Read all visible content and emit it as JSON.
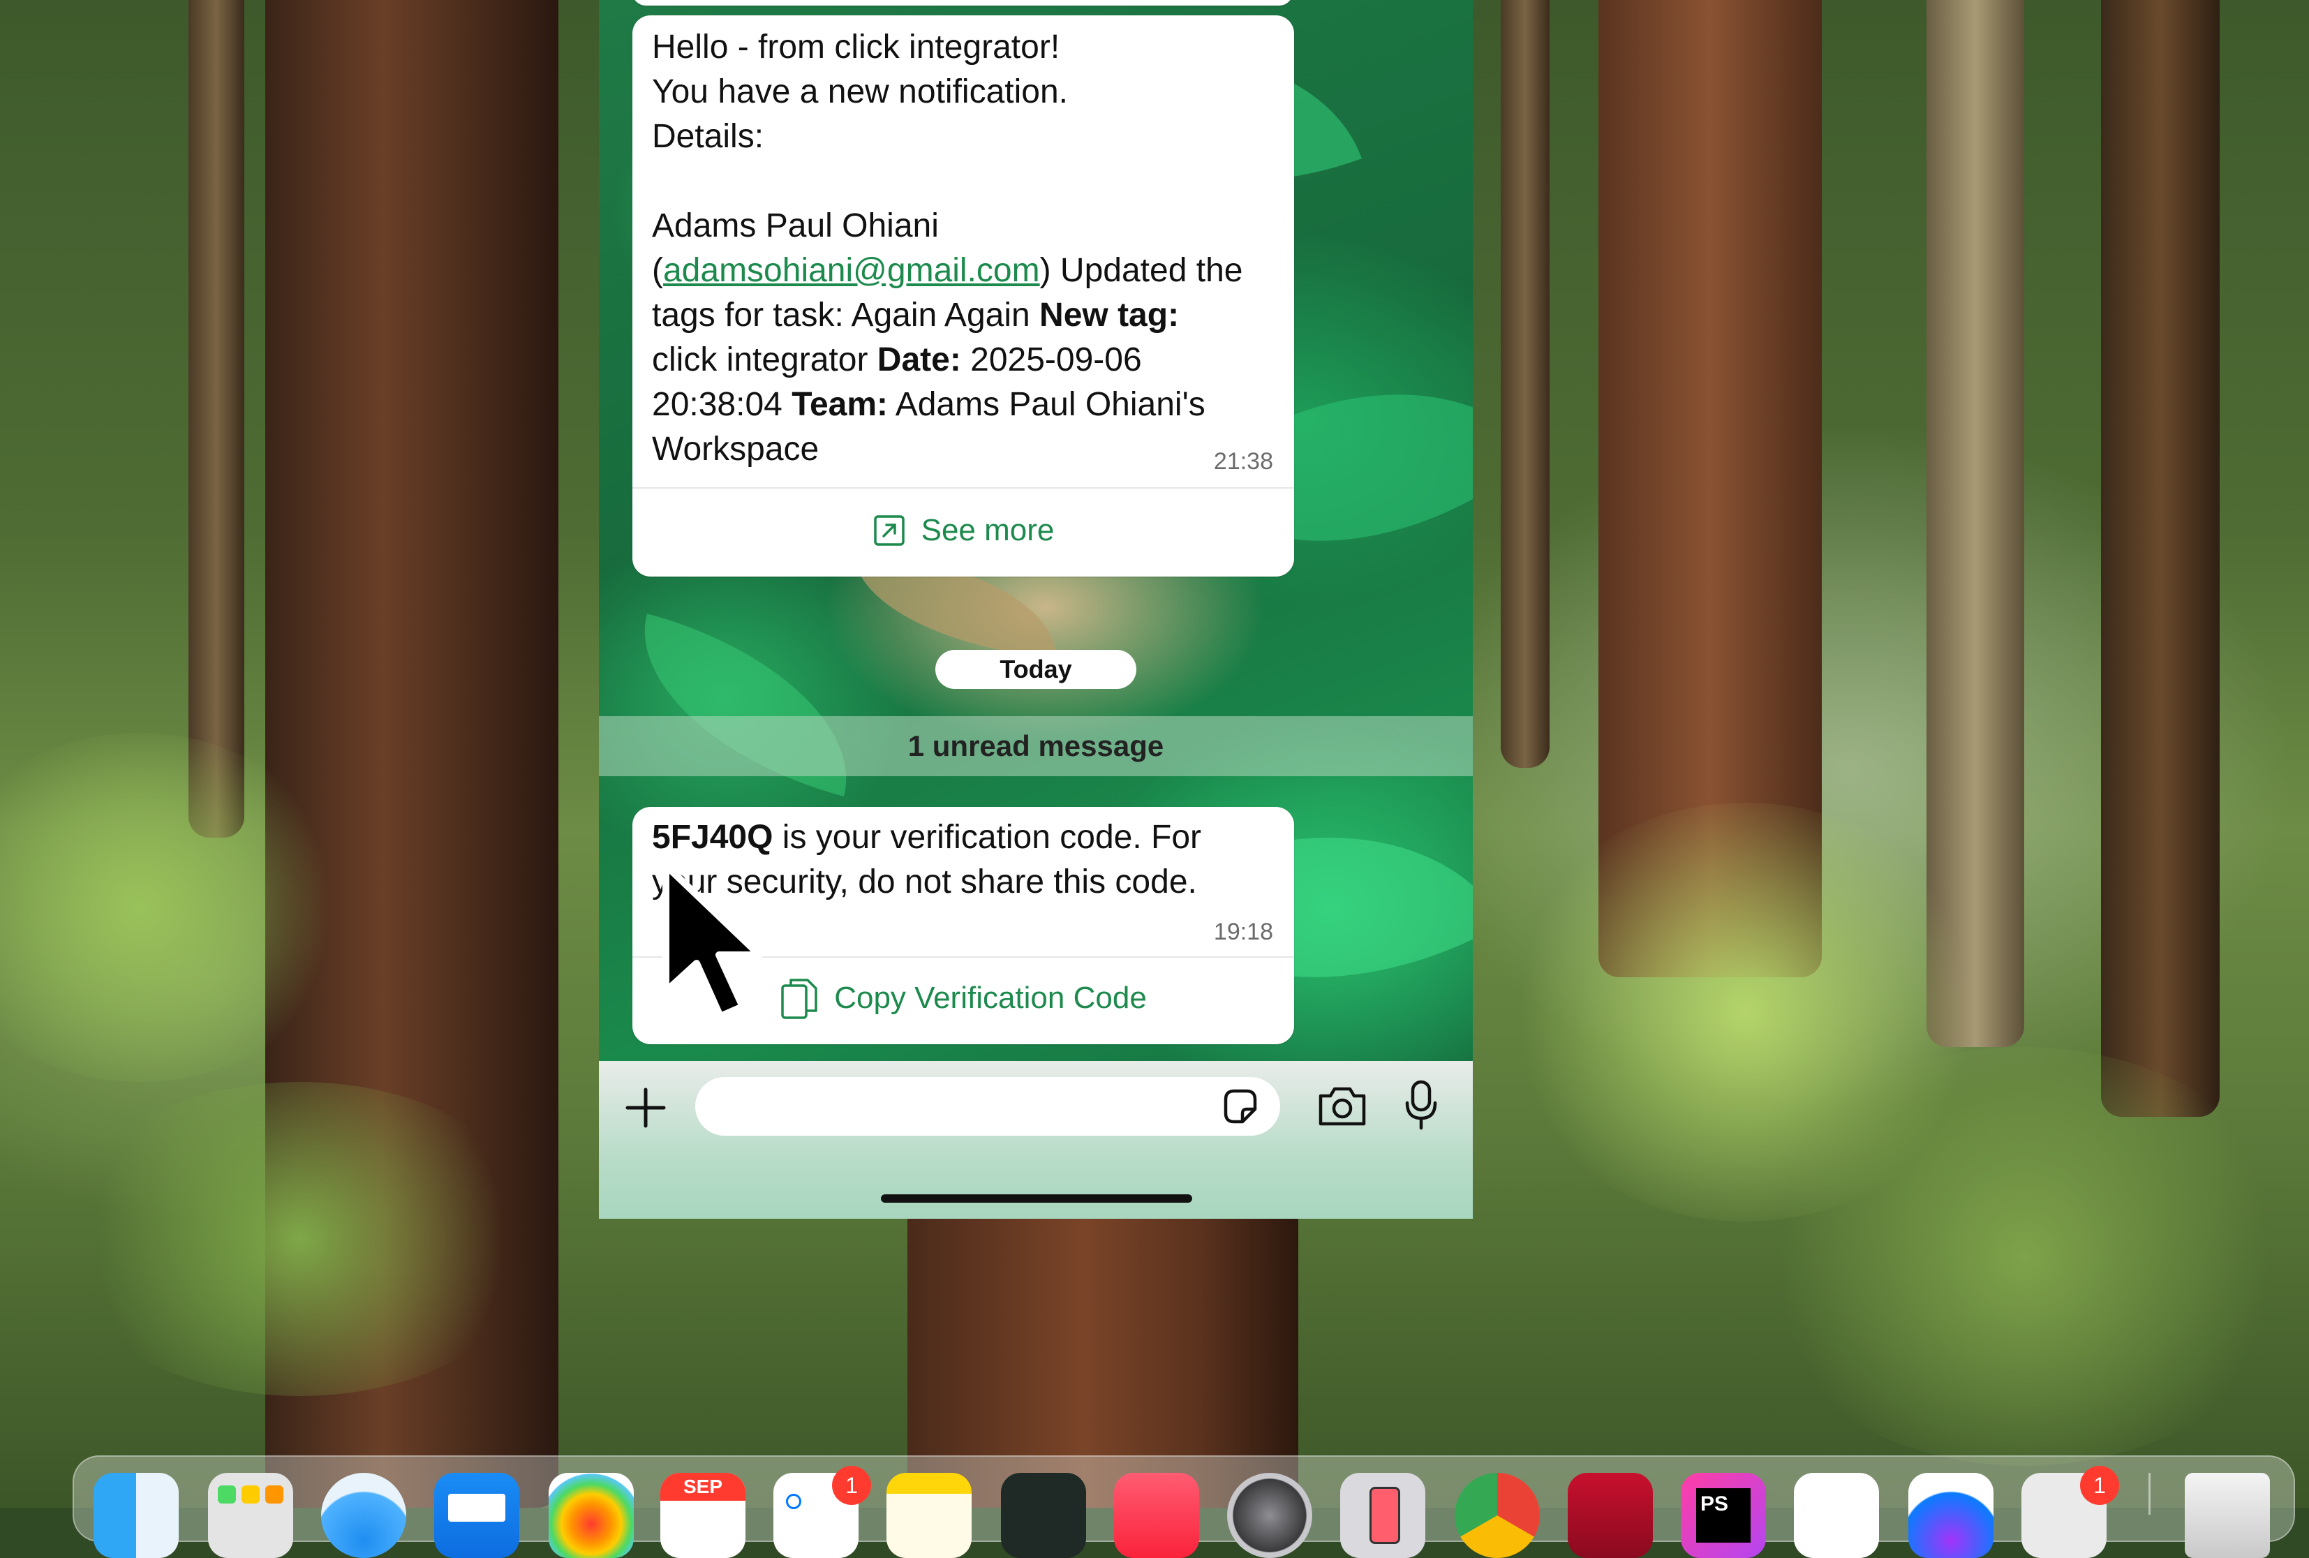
{
  "chat": {
    "message1": {
      "line1": "Hello - from click integrator!",
      "line2": "You have a new notification.",
      "line3": "Details:",
      "name": "Adams Paul Ohiani",
      "email": "adamsohiani@gmail.com",
      "after_email": ") Updated the",
      "task_prefix": "tags for task: Again Again ",
      "newtag_label": "New tag:",
      "newtag_value": "click integrator ",
      "date_label": "Date:",
      "date_value": " 2025-09-06",
      "time_value": "20:38:04 ",
      "team_label": "Team:",
      "team_value": " Adams Paul Ohiani's",
      "workspace": "Workspace",
      "timestamp": "21:38",
      "action_label": "See more"
    },
    "date_separator": "Today",
    "unread_banner": "1 unread message",
    "message2": {
      "code": "5FJ40Q",
      "line1_rest": " is your verification code. For",
      "line2": "your security, do not share this code.",
      "timestamp": "19:18",
      "action_label": "Copy Verification Code"
    },
    "input_placeholder": ""
  },
  "dock": {
    "icons": [
      "finder-icon",
      "launchpad-icon",
      "safari-icon",
      "mail-icon",
      "photos-icon",
      "calendar-icon",
      "reminders-icon",
      "notes-icon",
      "terminal-icon",
      "music-icon",
      "system-settings-icon",
      "iphone-mirroring-icon",
      "chrome-icon",
      "printer-icon",
      "phpstorm-icon",
      "chatgpt-icon",
      "messenger-icon",
      "downloads-icon",
      "trash-icon"
    ],
    "calendar_month": "SEP",
    "reminders_badge": "1",
    "downloads_badge": "1",
    "phpstorm_label": "PS"
  },
  "colors": {
    "accent_green": "#1d8a4d",
    "badge_red": "#ff3b30"
  }
}
